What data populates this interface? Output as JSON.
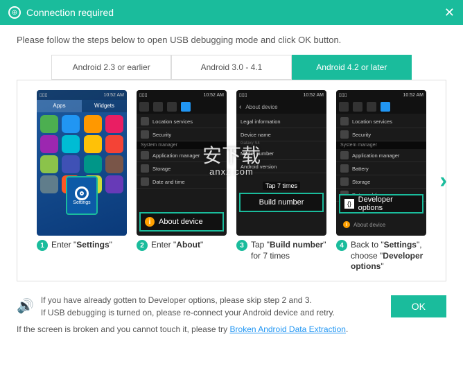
{
  "titlebar": {
    "title": "Connection required"
  },
  "instruction": "Please follow the steps below to open USB debugging mode and click OK button.",
  "tabs": [
    {
      "label": "Android 2.3 or earlier",
      "active": false
    },
    {
      "label": "Android 3.0 - 4.1",
      "active": false
    },
    {
      "label": "Android 4.2 or later",
      "active": true
    }
  ],
  "phone1": {
    "home_tabs": [
      "Apps",
      "Widgets"
    ],
    "settings_label": "Settings"
  },
  "phone2": {
    "rows": [
      "Location services",
      "Security",
      "Application manager",
      "Storage",
      "Date and time"
    ],
    "section": "System manager",
    "highlight": "About device"
  },
  "phone3": {
    "header": "About device",
    "rows": [
      "Legal information",
      "Device name",
      "Model number",
      "Android version"
    ],
    "highlight": "Build number",
    "tap_text": "Tap 7 times"
  },
  "phone4": {
    "rows": [
      "Location services",
      "Security",
      "Application manager",
      "Battery",
      "Storage",
      "Date and time"
    ],
    "section": "System manager",
    "highlight": "Developer options",
    "about_small": "About device"
  },
  "steps": [
    {
      "num": "1",
      "prefix": "Enter \"",
      "bold": "Settings",
      "suffix": "\""
    },
    {
      "num": "2",
      "prefix": "Enter \"",
      "bold": "About",
      "suffix": "\""
    },
    {
      "num": "3",
      "prefix": "Tap \"",
      "bold": "Build number",
      "suffix": "\" for 7 times"
    },
    {
      "num": "4",
      "prefix": "Back to \"",
      "bold": "Settings",
      "mid": "\", choose \"",
      "bold2": "Developer options",
      "suffix": "\""
    }
  ],
  "footer": {
    "line1": "If you have already gotten to Developer options, please skip step 2 and 3.",
    "line2": "If USB debugging is turned on, please re-connect your Android device and retry.",
    "ok": "OK"
  },
  "bottom": {
    "text": "If the screen is broken and you cannot touch it, please try ",
    "link": "Broken Android Data Extraction",
    "period": "."
  },
  "watermark": {
    "main": "安下载",
    "sub": "anxz.com"
  }
}
